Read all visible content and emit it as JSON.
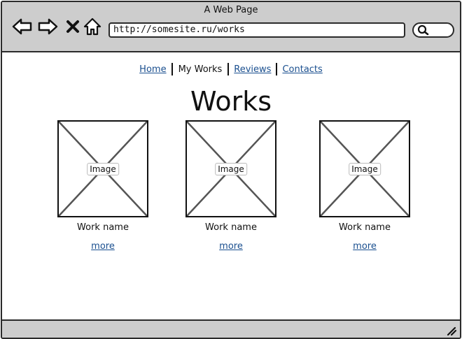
{
  "window": {
    "title": "A Web Page"
  },
  "browser": {
    "url": "http://somesite.ru/works",
    "icons": [
      "back-arrow-icon",
      "forward-arrow-icon",
      "close-icon",
      "home-icon",
      "search-icon"
    ]
  },
  "nav": {
    "home": "Home",
    "my_works": "My Works",
    "reviews": "Reviews",
    "contacts": "Contacts"
  },
  "page": {
    "title": "Works"
  },
  "works": [
    {
      "image_label": "Image",
      "name": "Work name",
      "more": "more"
    },
    {
      "image_label": "Image",
      "name": "Work name",
      "more": "more"
    },
    {
      "image_label": "Image",
      "name": "Work name",
      "more": "more"
    }
  ]
}
